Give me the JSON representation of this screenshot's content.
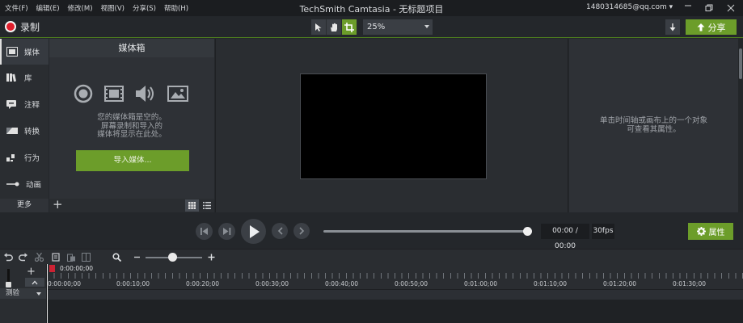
{
  "menu": [
    "文件(F)",
    "编辑(E)",
    "修改(M)",
    "视图(V)",
    "分享(S)",
    "帮助(H)"
  ],
  "window": {
    "title": "TechSmith Camtasia - 无标题项目",
    "account": "1480314685@qq.com ▾"
  },
  "toolbar": {
    "record_label": "录制",
    "zoom_value": "25%",
    "share_label": "分享"
  },
  "nav": {
    "items": [
      "媒体",
      "库",
      "注释",
      "转换",
      "行为",
      "动画"
    ],
    "more_label": "更多",
    "active": "媒体"
  },
  "media_bin": {
    "title": "媒体箱",
    "empty_line1": "您的媒体箱是空的。",
    "empty_line2": "屏幕录制和导入的",
    "empty_line3": "媒体将显示在此处。",
    "import_label": "导入媒体..."
  },
  "properties": {
    "hint_line1": "单击时间轴或画布上的一个对象",
    "hint_line2": "可查看其属性。",
    "button_label": "属性"
  },
  "playback": {
    "time": "00:00 / 00:00",
    "fps": "30fps",
    "position": 1.0
  },
  "timeline": {
    "playhead_time": "0:00:00;00",
    "ruler_labels": [
      "0:00:00;00",
      "0:00:10;00",
      "0:00:20;00",
      "0:00:30;00",
      "0:00:40;00",
      "0:00:50;00",
      "0:01:00;00",
      "0:01:10;00",
      "0:01:20;00",
      "0:01:30;00"
    ],
    "track_label": "测验",
    "zoom_level": 0.5
  },
  "colors": {
    "accent": "#6c9d2a",
    "record": "#e01e2c"
  }
}
